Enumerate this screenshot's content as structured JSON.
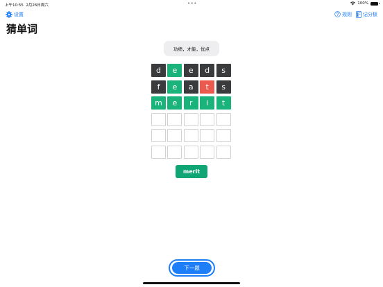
{
  "status_bar": {
    "time": "上午10:55",
    "date": "2月26日周六",
    "battery": "100%"
  },
  "nav": {
    "settings_label": "设置",
    "rules_label": "规则",
    "score_label": "记分板"
  },
  "page": {
    "title": "猜单词"
  },
  "hint": {
    "text": "功绩，才能，优点"
  },
  "board": {
    "rows": [
      [
        {
          "letter": "d",
          "state": "gray"
        },
        {
          "letter": "e",
          "state": "green"
        },
        {
          "letter": "e",
          "state": "gray"
        },
        {
          "letter": "d",
          "state": "gray"
        },
        {
          "letter": "s",
          "state": "gray"
        }
      ],
      [
        {
          "letter": "f",
          "state": "gray"
        },
        {
          "letter": "e",
          "state": "green"
        },
        {
          "letter": "a",
          "state": "gray"
        },
        {
          "letter": "t",
          "state": "red"
        },
        {
          "letter": "s",
          "state": "gray"
        }
      ],
      [
        {
          "letter": "m",
          "state": "green"
        },
        {
          "letter": "e",
          "state": "green"
        },
        {
          "letter": "r",
          "state": "green"
        },
        {
          "letter": "i",
          "state": "green"
        },
        {
          "letter": "t",
          "state": "green"
        }
      ],
      [
        {
          "letter": "",
          "state": "empty"
        },
        {
          "letter": "",
          "state": "empty"
        },
        {
          "letter": "",
          "state": "empty"
        },
        {
          "letter": "",
          "state": "empty"
        },
        {
          "letter": "",
          "state": "empty"
        }
      ],
      [
        {
          "letter": "",
          "state": "empty"
        },
        {
          "letter": "",
          "state": "empty"
        },
        {
          "letter": "",
          "state": "empty"
        },
        {
          "letter": "",
          "state": "empty"
        },
        {
          "letter": "",
          "state": "empty"
        }
      ],
      [
        {
          "letter": "",
          "state": "empty"
        },
        {
          "letter": "",
          "state": "empty"
        },
        {
          "letter": "",
          "state": "empty"
        },
        {
          "letter": "",
          "state": "empty"
        },
        {
          "letter": "",
          "state": "empty"
        }
      ]
    ]
  },
  "answer": {
    "word": "merit"
  },
  "actions": {
    "next_label": "下一题"
  },
  "colors": {
    "accent": "#1e7ef7",
    "tile_gray": "#3a3b3d",
    "tile_green": "#1ab37c",
    "tile_red": "#ea5a4f",
    "answer_bg": "#10a574"
  },
  "icons": {
    "settings": "gear-icon",
    "rules": "question-circle-icon",
    "score": "scoreboard-icon",
    "wifi": "wifi-icon",
    "battery": "battery-icon"
  }
}
